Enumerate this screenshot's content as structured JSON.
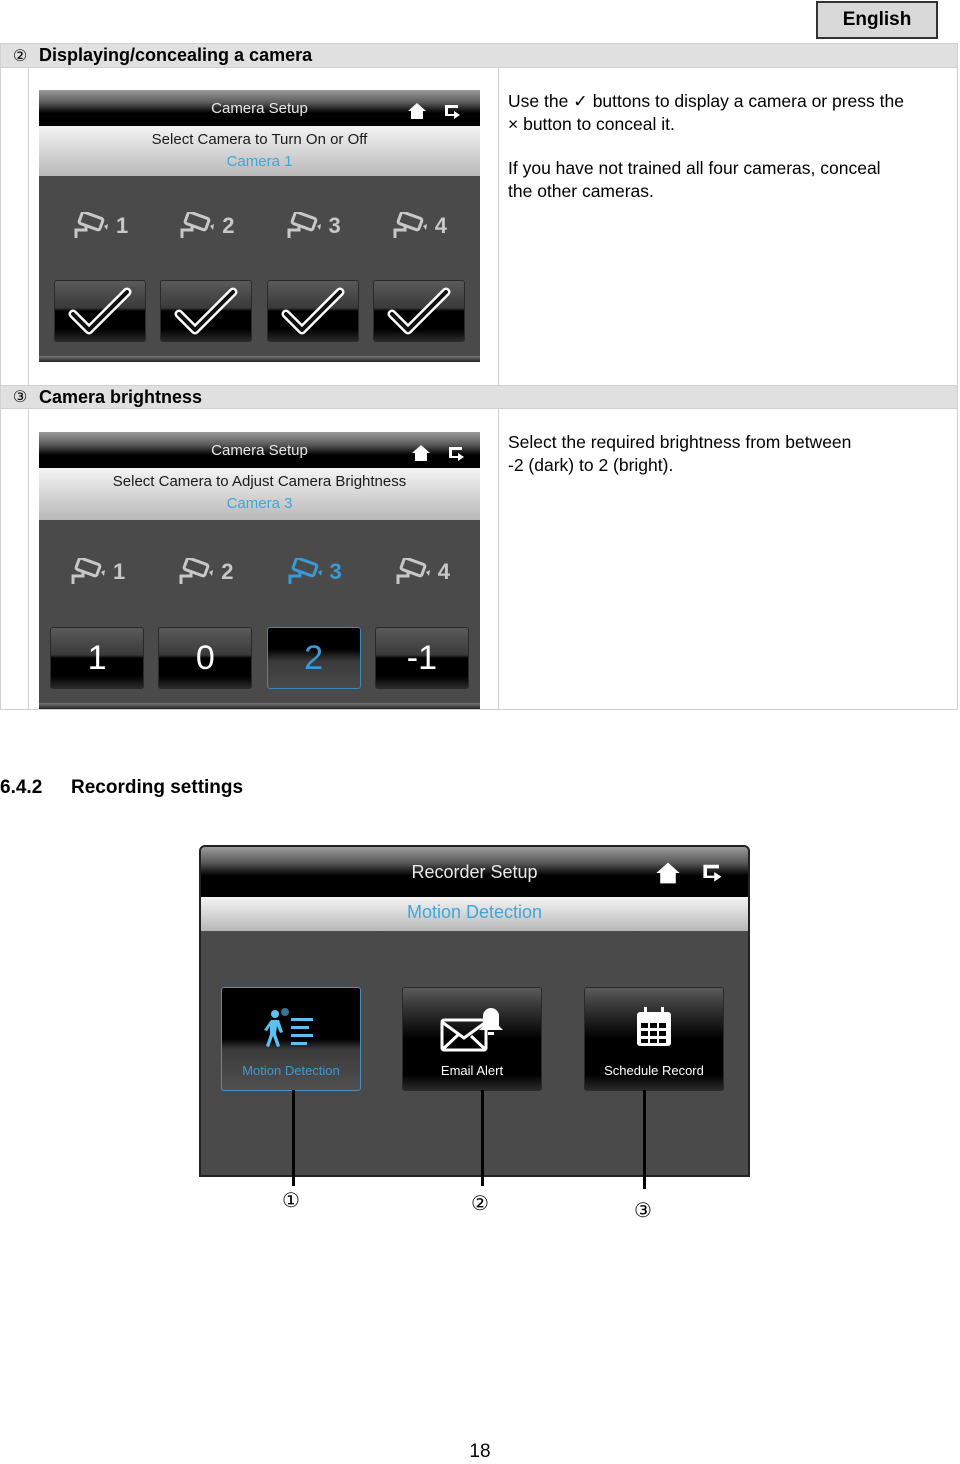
{
  "header": {
    "language": "English"
  },
  "table": {
    "rows": [
      {
        "number": "②",
        "title": "Displaying/concealing a camera",
        "description": [
          "Use the ✓ buttons to display a camera or press the",
          "× button to conceal it.",
          "If you have not trained all four cameras, conceal",
          "the other cameras."
        ],
        "screen": {
          "title": "Camera Setup",
          "subtitle": "Select Camera to Turn On or Off",
          "selected_camera": "Camera 1",
          "cameras": [
            "1",
            "2",
            "3",
            "4"
          ],
          "active_camera_index": null,
          "buttons": [
            "check",
            "check",
            "check",
            "check"
          ]
        }
      },
      {
        "number": "③",
        "title": "Camera brightness",
        "description": [
          "Select the required brightness from between",
          "-2 (dark) to 2 (bright)."
        ],
        "screen": {
          "title": "Camera Setup",
          "subtitle": "Select Camera to Adjust Camera Brightness",
          "selected_camera": "Camera 3",
          "cameras": [
            "1",
            "2",
            "3",
            "4"
          ],
          "active_camera_index": 2,
          "buttons": [
            "1",
            "0",
            "2",
            "-1"
          ],
          "selected_button_index": 2
        }
      }
    ]
  },
  "section": {
    "number": "6.4.2",
    "title": "Recording settings"
  },
  "recorder_screen": {
    "title": "Recorder Setup",
    "subtitle": "Motion Detection",
    "buttons": [
      {
        "label": "Motion Detection",
        "icon": "motion-detection-icon",
        "selected": true
      },
      {
        "label": "Email Alert",
        "icon": "email-alert-icon",
        "selected": false
      },
      {
        "label": "Schedule Record",
        "icon": "calendar-icon",
        "selected": false
      }
    ],
    "callouts": [
      "①",
      "②",
      "③"
    ]
  },
  "colors": {
    "accent": "#3a9ad8",
    "header_gray": "#e0e0e0",
    "screen_bg": "#4a4a4a"
  },
  "page_number": "18"
}
